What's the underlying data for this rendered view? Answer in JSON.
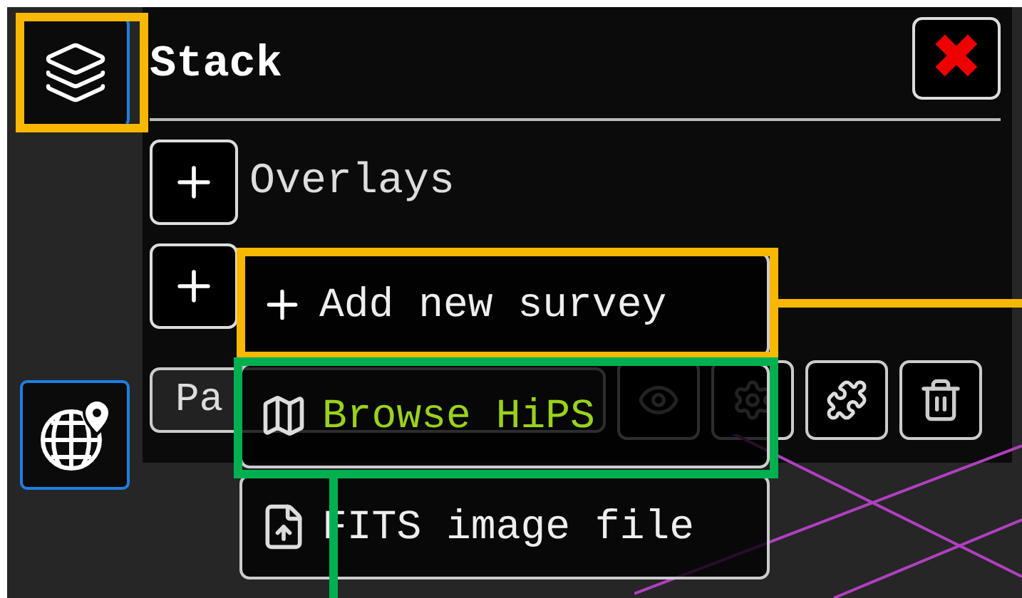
{
  "panel": {
    "title": "Stack",
    "close": "✖"
  },
  "sections": [
    {
      "label": "Overlays"
    }
  ],
  "layer": {
    "name": "Pa"
  },
  "menu": [
    {
      "kind": "add",
      "label": "Add new survey",
      "selected": false
    },
    {
      "kind": "hips",
      "label": "Browse HiPS",
      "selected": true
    },
    {
      "kind": "fits",
      "label": "FITS image file",
      "selected": false
    }
  ],
  "annotations": [
    {
      "kind": "stack",
      "color": "#f8b800"
    },
    {
      "kind": "add",
      "color": "#f8b800"
    },
    {
      "kind": "hips",
      "color": "#00b050"
    }
  ]
}
